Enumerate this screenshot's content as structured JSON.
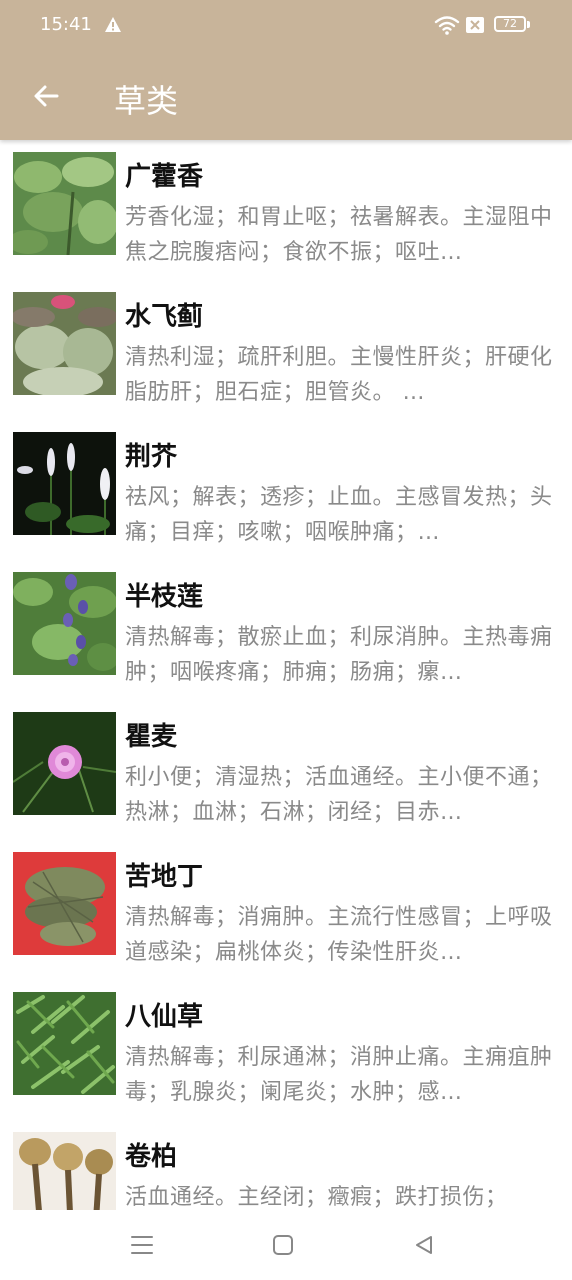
{
  "status_bar": {
    "time": "15:41",
    "battery": "72",
    "icons": [
      "warning-icon",
      "wifi-icon",
      "sim-icon",
      "battery-icon"
    ]
  },
  "app_bar": {
    "title": "草类",
    "back_icon": "arrow-left-icon",
    "background_color": "#c8b49a"
  },
  "items": [
    {
      "title": "广藿香",
      "desc": "芳香化湿；和胃止呕；祛暑解表。主湿阻中焦之脘腹痞闷；食欲不振；呕吐…",
      "image": "green-broad-leaves"
    },
    {
      "title": "水飞蓟",
      "desc": "清热利湿；疏肝利胆。主慢性肝炎；肝硬化脂肪肝；胆石症；胆管炎。 …",
      "image": "variegated-thistle-with-pink-flower"
    },
    {
      "title": "荆芥",
      "desc": "祛风；解表；透疹；止血。主感冒发热；头痛；目痒；咳嗽；咽喉肿痛；…",
      "image": "white-flower-spikes-dark-background"
    },
    {
      "title": "半枝莲",
      "desc": "清热解毒；散瘀止血；利尿消肿。主热毒痈肿；咽喉疼痛；肺痈；肠痈；瘰…",
      "image": "purple-flowers-green-leaves"
    },
    {
      "title": "瞿麦",
      "desc": "利小便；清湿热；活血通经。主小便不通；热淋；血淋；石淋；闭经；目赤…",
      "image": "pink-fringed-flower"
    },
    {
      "title": "苦地丁",
      "desc": "清热解毒；消痈肿。主流行性感冒；上呼吸道感染；扁桃体炎；传染性肝炎…",
      "image": "dried-herb-on-red-background"
    },
    {
      "title": "八仙草",
      "desc": "清热解毒；利尿通淋；消肿止痛。主痈疽肿毒；乳腺炎；阑尾炎；水肿；感…",
      "image": "dense-green-narrow-leaves"
    },
    {
      "title": "卷柏",
      "desc": "活血通经。主经闭；癥瘕；跌打损伤；",
      "image": "dried-curled-roots"
    }
  ],
  "nav_bar": {
    "icons": [
      "menu-icon",
      "home-square-icon",
      "back-triangle-icon"
    ]
  }
}
